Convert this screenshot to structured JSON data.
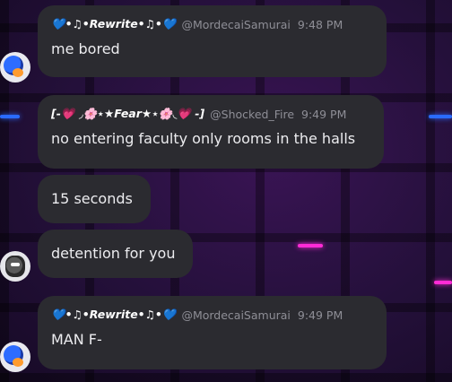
{
  "messages": [
    {
      "nickname": "💙•♫•Rewrite•♫•💙",
      "handle": "@MordecaiSamurai",
      "time": "9:48 PM",
      "text": "me bored"
    },
    {
      "nickname": "[-💗 ◞🌸⋆★Fear★⋆🌸◟💗 -]",
      "handle": "@Shocked_Fire",
      "time": "9:49 PM",
      "text": "no entering faculty only rooms in the halls"
    },
    {
      "text": "15 seconds"
    },
    {
      "text": "detention for you"
    },
    {
      "nickname": "💙•♫•Rewrite•♫•💙",
      "handle": "@MordecaiSamurai",
      "time": "9:49 PM",
      "text": "MAN F-"
    }
  ],
  "colors": {
    "bubble": "#2b2b30",
    "meta": "#8e8e96",
    "text": "#ececef",
    "accent_blue": "#2a6bff",
    "accent_pink": "#ff2bd6"
  }
}
